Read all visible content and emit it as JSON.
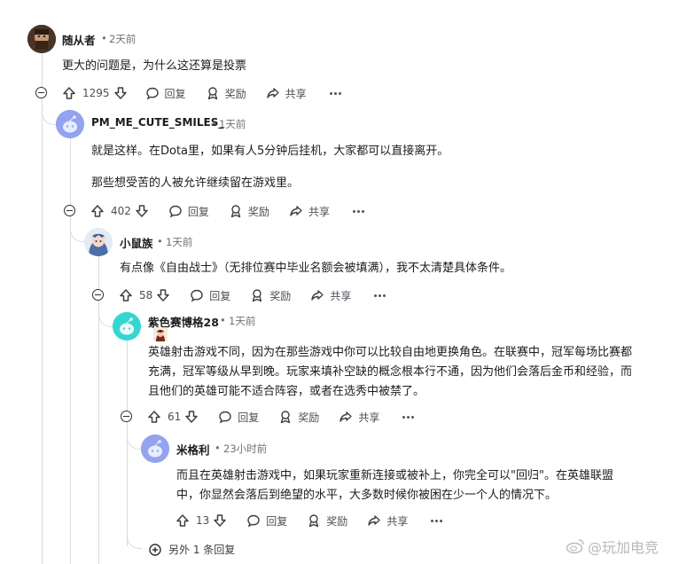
{
  "comments": [
    {
      "user": "随从者",
      "time": "2天前",
      "lines": [
        "更大的问题是，为什么这还算是投票"
      ],
      "votes": "1295",
      "reply": "回复",
      "award": "奖励",
      "share": "共享"
    },
    {
      "user": "PM_ME_CUTE_SMILES_",
      "time": "1天前",
      "lines": [
        "就是这样。在Dota里，如果有人5分钟后挂机，大家都可以直接离开。",
        "那些想受苦的人被允许继续留在游戏里。"
      ],
      "votes": "402",
      "reply": "回复",
      "award": "奖励",
      "share": "共享"
    },
    {
      "user": "小鼠族",
      "time": "1天前",
      "lines": [
        "有点像《自由战士》（无排位赛中毕业名额会被填满），我不太清楚具体条件。"
      ],
      "votes": "58",
      "reply": "回复",
      "award": "奖励",
      "share": "共享"
    },
    {
      "user": "紫色赛博格28",
      "time": "1天前",
      "lines": [
        "英雄射击游戏不同，因为在那些游戏中你可以比较自由地更换角色。在联赛中，冠军每场比赛都",
        "充满，冠军等级从早到晚。玩家来填补空缺的概念根本行不通，因为他们会落后金币和经验，而",
        "且他们的英雄可能不适合阵容，或者在选秀中被禁了。"
      ],
      "votes": "61",
      "reply": "回复",
      "award": "奖励",
      "share": "共享"
    },
    {
      "user": "米格利",
      "time": "23小时前",
      "lines": [
        "而且在英雄射击游戏中，如果玩家重新连接或被补上，你完全可以\"回归\"。在英雄联盟",
        "中，你显然会落后到绝望的水平，大多数时候你被困在少一个人的情况下。"
      ],
      "votes": "13",
      "reply": "回复",
      "award": "奖励",
      "share": "共享"
    }
  ],
  "more_replies": "另外 1 条回复",
  "watermark": "@玩加电竞",
  "separator": "•",
  "icons": [
    "upvote-icon",
    "downvote-icon",
    "reply-icon",
    "award-icon",
    "share-icon",
    "more-icon",
    "collapse-icon",
    "expand-icon"
  ]
}
